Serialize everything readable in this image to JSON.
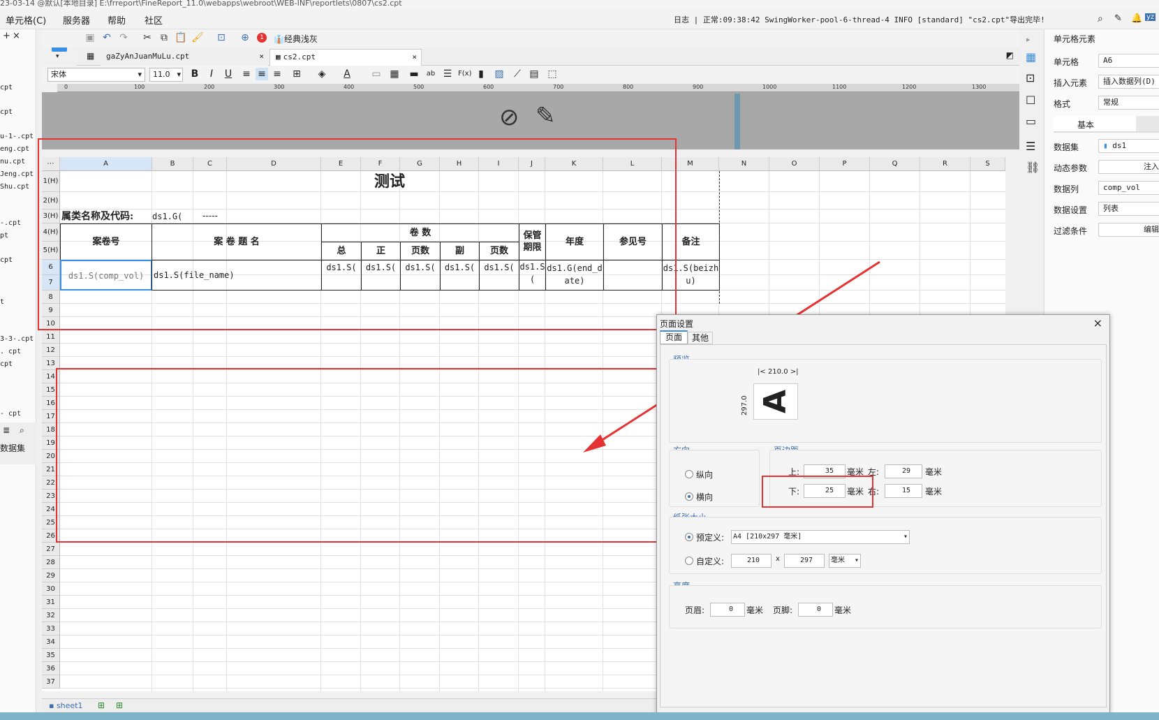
{
  "window": {
    "title": "23-03-14 @默认[本地目录]    E:\\frreport\\FineReport_11.0\\webapps\\webroot\\WEB-INF\\reportlets\\0807\\cs2.cpt"
  },
  "menu": {
    "items": [
      "单元格(C)",
      "服务器",
      "帮助",
      "社区"
    ]
  },
  "log": {
    "text": "日志 | 正常:09:38:42 SwingWorker-pool-6-thread-4 INFO [standard] \"cs2.cpt\"导出完毕!"
  },
  "left_files": [
    "cpt",
    "cpt",
    "u-1-.cpt",
    "eng.cpt",
    "nu.cpt",
    "Jeng.cpt",
    "Shu.cpt",
    "-.cpt",
    "pt",
    "cpt",
    "t",
    "3-3-.cpt",
    ". cpt",
    "cpt",
    "- cpt"
  ],
  "left_bottom": {
    "dataset_label": "数据集"
  },
  "toolbar": {
    "classic_label": "经典浅灰",
    "badge": "1"
  },
  "tabs": [
    {
      "label": "gaZyAnJuanMuLu.cpt"
    },
    {
      "label": "cs2.cpt"
    }
  ],
  "format": {
    "font": "宋体",
    "size": "11.0"
  },
  "ruler": {
    "ticks": [
      "0",
      "100",
      "200",
      "300",
      "400",
      "500",
      "600",
      "700",
      "800",
      "900",
      "1000",
      "1100",
      "1200",
      "1300"
    ]
  },
  "columns": [
    "A",
    "B",
    "C",
    "D",
    "E",
    "F",
    "G",
    "H",
    "I",
    "J",
    "K",
    "L",
    "M",
    "N",
    "O",
    "P",
    "Q",
    "R",
    "S"
  ],
  "rows": [
    "1(H)",
    "2(H)",
    "3(H)",
    "4(H)",
    "5(H)",
    "6",
    "7",
    "8",
    "9",
    "10",
    "11",
    "12",
    "13",
    "14",
    "15",
    "16",
    "17",
    "18",
    "19",
    "20",
    "21",
    "22",
    "23",
    "24",
    "25",
    "26",
    "27",
    "28",
    "29",
    "30",
    "31",
    "32",
    "33",
    "34",
    "35",
    "36",
    "37"
  ],
  "report": {
    "title": "测试",
    "category_label": "属类名称及代码:",
    "category_value": "ds1.G(",
    "category_dash": "-----",
    "h_case_no": "案卷号",
    "h_case_title": "案 卷 题 名",
    "h_volumes": "卷   数",
    "h_total": "总",
    "h_main": "正",
    "h_pages1": "页数",
    "h_sub": "副",
    "h_pages2": "页数",
    "h_period": "保管期限",
    "h_year": "年度",
    "h_ref": "参见号",
    "h_note": "备注",
    "d_comp_vol": "ds1.S(comp_vol)",
    "d_file_name": "ds1.S(file_name)",
    "d_e": "ds1.S(",
    "d_f": "ds1.S(",
    "d_g": "ds1.S(",
    "d_h": "ds1.S(",
    "d_i": "ds1.S(",
    "d_j": "ds1.S(",
    "d_k": "ds1.G(end_date)",
    "d_m": "ds1.S(beizhu)"
  },
  "sheet": {
    "name": "sheet1"
  },
  "right_panel": {
    "title": "单元格元素",
    "cell_label": "单元格",
    "cell_value": "A6",
    "insert_label": "插入元素",
    "insert_value": "插入数据列(D)",
    "format_label": "格式",
    "format_value": "常规",
    "basic_tab": "基本",
    "dataset_label": "数据集",
    "dataset_value": "ds1",
    "dynparam_label": "动态参数",
    "dynparam_value": "注入",
    "datacol_label": "数据列",
    "datacol_value": "comp_vol",
    "dataset_setting_label": "数据设置",
    "dataset_setting_value": "列表",
    "filter_label": "过滤条件",
    "filter_value": "编辑",
    "user": "yz"
  },
  "dialog": {
    "title": "页面设置",
    "tab_page": "页面",
    "tab_other": "其他",
    "preview_label": "预览",
    "preview_width": "210.0",
    "preview_height": "297.0",
    "preview_letter": "A",
    "direction_label": "方向",
    "portrait": "纵向",
    "landscape": "横向",
    "margin_label": "页边距",
    "top_label": "上:",
    "top_value": "35",
    "bottom_label": "下:",
    "bottom_value": "25",
    "left_label": "左:",
    "left_value": "29",
    "right_label": "右:",
    "right_value": "15",
    "unit": "毫米",
    "paper_label": "纸张大小",
    "predefined_label": "预定义:",
    "predefined_value": "A4 [210x297 毫米]",
    "custom_label": "自定义:",
    "custom_w": "210",
    "custom_x": "x",
    "custom_h": "297",
    "custom_unit": "毫米",
    "height_label": "高度",
    "header_label": "页眉:",
    "header_value": "0",
    "footer_label": "页脚:",
    "footer_value": "0"
  }
}
